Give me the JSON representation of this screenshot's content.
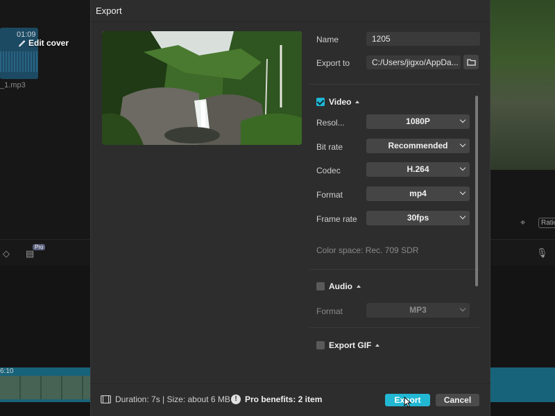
{
  "background": {
    "clip_time": "01:09",
    "clip_name": "_1.mp3",
    "timeline_time": "6:10",
    "ratio_label": "Ratio",
    "pro_tag": "Pro"
  },
  "dialog": {
    "title": "Export",
    "edit_cover_label": "Edit cover",
    "name_label": "Name",
    "name_value": "1205",
    "export_to_label": "Export to",
    "export_to_value": "C:/Users/jigxo/AppDa...",
    "video": {
      "title": "Video",
      "checked": true,
      "resolution_label": "Resol...",
      "resolution_value": "1080P",
      "bitrate_label": "Bit rate",
      "bitrate_value": "Recommended",
      "codec_label": "Codec",
      "codec_value": "H.264",
      "format_label": "Format",
      "format_value": "mp4",
      "framerate_label": "Frame rate",
      "framerate_value": "30fps",
      "color_space": "Color space: Rec. 709 SDR"
    },
    "audio": {
      "title": "Audio",
      "checked": false,
      "format_label": "Format",
      "format_value": "MP3"
    },
    "gif": {
      "title": "Export GIF",
      "checked": false
    },
    "footer": {
      "info": "Duration: 7s | Size: about 6 MB",
      "pro_benefits": "Pro benefits: 2 item",
      "export_button": "Export",
      "cancel_button": "Cancel"
    }
  },
  "colors": {
    "accent": "#22b8d3",
    "dialog_bg": "#2d2d2d",
    "select_bg": "#454545"
  },
  "icons": [
    "edit-icon",
    "folder-icon",
    "film-icon",
    "info-icon",
    "chevron-down-icon",
    "caret-up-icon"
  ]
}
